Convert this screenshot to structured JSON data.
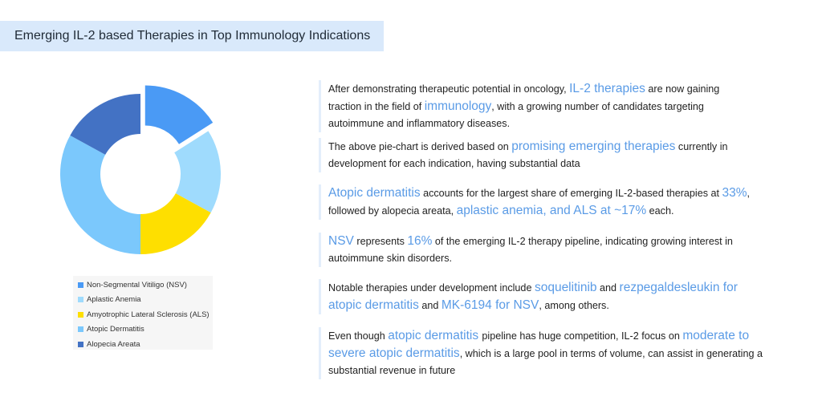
{
  "title": "Emerging IL-2 based Therapies in Top Immunology Indications",
  "chart_data": {
    "type": "pie",
    "style": "donut",
    "title": "",
    "categories": [
      "Non-Segmental Vitiligo (NSV)",
      "Aplastic Anemia",
      "Amyotrophic Lateral Sclerosis (ALS)",
      "Atopic Dermatitis",
      "Alopecia Areata"
    ],
    "values": [
      16,
      17,
      17,
      33,
      17
    ],
    "colors": [
      "#4a9af5",
      "#9fdbfd",
      "#fedf00",
      "#7bc8fc",
      "#4372c4"
    ],
    "exploded": [
      "Non-Segmental Vitiligo (NSV)"
    ],
    "legend_position": "bottom"
  },
  "legend": [
    {
      "label": "Non-Segmental Vitiligo (NSV)",
      "color": "#4a9af5"
    },
    {
      "label": "Aplastic Anemia",
      "color": "#9fdbfd"
    },
    {
      "label": "Amyotrophic Lateral Sclerosis (ALS)",
      "color": "#fedf00"
    },
    {
      "label": "Atopic Dermatitis",
      "color": "#7bc8fc"
    },
    {
      "label": "Alopecia Areata",
      "color": "#4372c4"
    }
  ],
  "paragraphs": [
    [
      {
        "t": "After demonstrating therapeutic potential in oncology, "
      },
      {
        "t": "IL-2 therapies",
        "h": true
      },
      {
        "t": " are now gaining traction in the field of "
      },
      {
        "t": "immunology",
        "h": true
      },
      {
        "t": ", with a growing number of candidates targeting autoimmune and inflammatory diseases."
      }
    ],
    [
      {
        "t": "The above pie-chart is derived based on "
      },
      {
        "t": "promising emerging therapies",
        "h": true
      },
      {
        "t": " currently in development for each indication, having substantial data"
      }
    ],
    [
      {
        "t": "Atopic dermatitis",
        "h": true
      },
      {
        "t": " accounts for the largest share of emerging IL-2-based therapies at "
      },
      {
        "t": "33%",
        "h": true
      },
      {
        "t": ", followed by alopecia areata, "
      },
      {
        "t": "aplastic anemia, and ALS at ~17%",
        "h": true
      },
      {
        "t": " each."
      }
    ],
    [
      {
        "t": "NSV",
        "h": true
      },
      {
        "t": " represents "
      },
      {
        "t": "16%",
        "h": true
      },
      {
        "t": " of the emerging IL-2 therapy pipeline, indicating growing interest in autoimmune skin disorders."
      }
    ],
    [
      {
        "t": "Notable therapies under development include "
      },
      {
        "t": "soquelitinib",
        "h": true
      },
      {
        "t": " and "
      },
      {
        "t": "rezpegaldesleukin for atopic dermatitis",
        "h": true
      },
      {
        "t": " and "
      },
      {
        "t": "MK-6194 for NSV",
        "h": true
      },
      {
        "t": ", among others."
      }
    ],
    [
      {
        "t": "Even though "
      },
      {
        "t": "atopic dermatitis ",
        "h": true
      },
      {
        "t": " pipeline has huge competition, IL-2 focus on "
      },
      {
        "t": "moderate to severe atopic dermatitis",
        "h": true
      },
      {
        "t": ", which is a large pool in terms of volume, can assist in generating a substantial revenue in future"
      }
    ]
  ]
}
